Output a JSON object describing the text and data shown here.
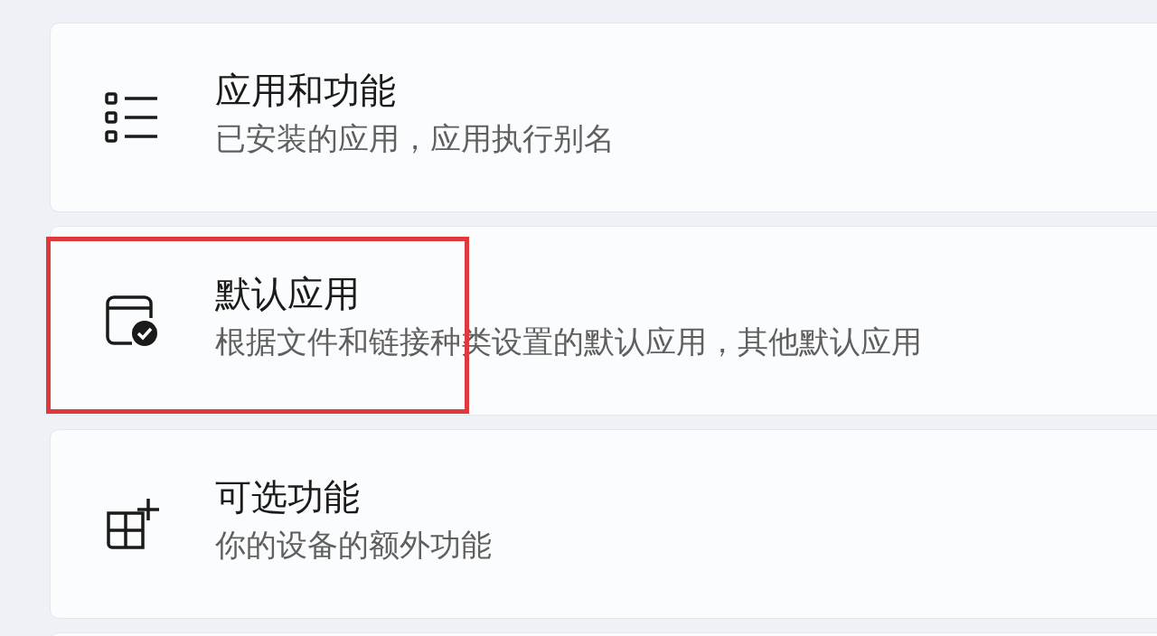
{
  "items": [
    {
      "kind": "list",
      "title": "应用和功能",
      "subtitle": "已安装的应用，应用执行别名",
      "highlighted": false
    },
    {
      "kind": "default",
      "title": "默认应用",
      "subtitle": "根据文件和链接种类设置的默认应用，其他默认应用",
      "highlighted": true
    },
    {
      "kind": "optional",
      "title": "可选功能",
      "subtitle": "你的设备的额外功能",
      "highlighted": false
    }
  ]
}
